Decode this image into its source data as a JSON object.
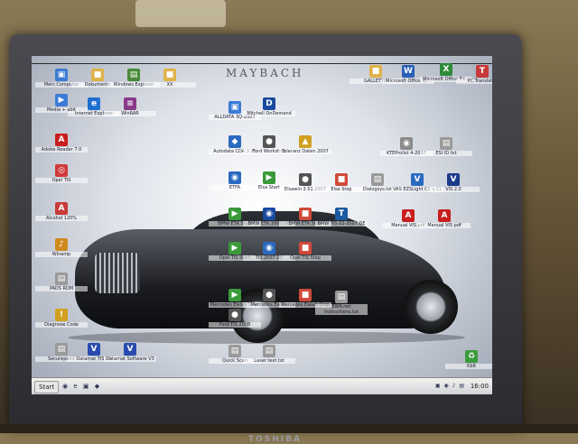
{
  "wallpaper": {
    "title": "MAYBACH"
  },
  "monitor": {
    "brand": "TOSHIBA"
  },
  "icons": [
    {
      "label": "Mein Computer",
      "name": "my-computer-icon",
      "color": "#3a7bd5",
      "glyph": "▣"
    },
    {
      "label": "Dokumente",
      "name": "documents-folder-icon",
      "color": "#e0b24a",
      "glyph": "■"
    },
    {
      "label": "Windows Explorer",
      "name": "windows-explorer-icon",
      "color": "#4a8a3a",
      "glyph": "▤"
    },
    {
      "label": "XX",
      "name": "folder-icon",
      "color": "#e0b24a",
      "glyph": "■"
    },
    {
      "label": "GALLETTO",
      "name": "galletto-folder-icon",
      "color": "#e0b24a",
      "glyph": "■"
    },
    {
      "label": "Microsoft Office W...",
      "name": "ms-word-icon",
      "color": "#2a5fb8",
      "glyph": "W"
    },
    {
      "label": "Microsoft Office Ex...",
      "name": "ms-excel-icon",
      "color": "#2e8b3a",
      "glyph": "X"
    },
    {
      "label": "PC Translator",
      "name": "pc-translator-icon",
      "color": "#c83a3a",
      "glyph": "T"
    },
    {
      "label": "Media + ablt",
      "name": "media-player-icon",
      "color": "#3a7bd5",
      "glyph": "▶"
    },
    {
      "label": "Internet Explorer",
      "name": "internet-explorer-icon",
      "color": "#1f6fcf",
      "glyph": "e"
    },
    {
      "label": "WinRAR",
      "name": "winrar-icon",
      "color": "#8a3a8a",
      "glyph": "≡"
    },
    {
      "label": "ALLDATA 3Q-2007",
      "name": "alldata-icon",
      "color": "#3a7bd5",
      "glyph": "▣"
    },
    {
      "label": "Mitchell OnDemand",
      "name": "mitchell-ondemand-icon",
      "color": "#1a4aa0",
      "glyph": "D"
    },
    {
      "label": "Adobe Reader 7.0",
      "name": "adobe-reader-icon",
      "color": "#c81e1e",
      "glyph": "A"
    },
    {
      "label": "Autodata CDA 3.15",
      "name": "autodata-icon",
      "color": "#2a6ac0",
      "glyph": "◆"
    },
    {
      "label": "Ford Workshop",
      "name": "ford-workshop-icon",
      "color": "#555",
      "glyph": "●"
    },
    {
      "label": "Toleranz Daten 2007",
      "name": "toleranz-daten-icon",
      "color": "#d0a020",
      "glyph": "▲"
    },
    {
      "label": "KTEProlist 4-2007",
      "name": "kte-prolist-icon",
      "color": "#8a8a8a",
      "glyph": "◉"
    },
    {
      "label": "ESI ID txt",
      "name": "esi-txt-icon",
      "color": "#9a9a9a",
      "glyph": "▤"
    },
    {
      "label": "Opel TIS",
      "name": "opel-tis-icon",
      "color": "#d03a3a",
      "glyph": "◎"
    },
    {
      "label": "ETFA",
      "name": "etfa-icon",
      "color": "#2a6ac0",
      "glyph": "◉"
    },
    {
      "label": "Elsa Start",
      "name": "elsa-start-icon",
      "color": "#3a9a3a",
      "glyph": "▶"
    },
    {
      "label": "Elsawin 3.51 2007",
      "name": "elsawin-icon",
      "color": "#555",
      "glyph": "●"
    },
    {
      "label": "Elsa Stop",
      "name": "elsa-stop-icon",
      "color": "#d04a3a",
      "glyph": "■"
    },
    {
      "label": "Dialogsys.txt",
      "name": "dialogsys-txt-icon",
      "color": "#9a9a9a",
      "glyph": "▤"
    },
    {
      "label": "VAS EZSLight CE v.11",
      "name": "vas-icon",
      "color": "#2a6ac0",
      "glyph": "V"
    },
    {
      "label": "VIS 2.0",
      "name": "vis-icon",
      "color": "#1a3a8a",
      "glyph": "V"
    },
    {
      "label": "Alcohol 120%",
      "name": "alcohol-icon",
      "color": "#c83a3a",
      "glyph": "A"
    },
    {
      "label": "BMW ETK Start",
      "name": "bmw-etk-start-icon",
      "color": "#3a9a3a",
      "glyph": "▶"
    },
    {
      "label": "BMW ETK 2007 DE",
      "name": "bmw-etk-icon",
      "color": "#1a4aa0",
      "glyph": "◉"
    },
    {
      "label": "BMW ETK Stop",
      "name": "bmw-etk-stop-icon",
      "color": "#d04a3a",
      "glyph": "■"
    },
    {
      "label": "BMW TIS 02-2007 DE",
      "name": "bmw-tis-icon",
      "color": "#1a5aa0",
      "glyph": "T"
    },
    {
      "label": "Manual VIS.pdf",
      "name": "manual-vis-pdf-icon",
      "color": "#c81e1e",
      "glyph": "A"
    },
    {
      "label": "Manual VIS pdf",
      "name": "manual-vis-pdf-2-icon",
      "color": "#c81e1e",
      "glyph": "A"
    },
    {
      "label": "Winamp",
      "name": "winamp-icon",
      "color": "#d08a20",
      "glyph": "♪"
    },
    {
      "label": "Opel TIS Start",
      "name": "opel-tis-start-icon",
      "color": "#3a9a3a",
      "glyph": "▶"
    },
    {
      "label": "TIS 2007 DE",
      "name": "tis-2007-icon",
      "color": "#2a6ac0",
      "glyph": "◉"
    },
    {
      "label": "Opel TIS Stop",
      "name": "opel-tis-stop-icon",
      "color": "#d04a3a",
      "glyph": "■"
    },
    {
      "label": "Mercedes Ewlab Start",
      "name": "mercedes-start-icon",
      "color": "#3a9a3a",
      "glyph": "▶"
    },
    {
      "label": "Mercedes Ewlab",
      "name": "mercedes-ewlab-icon",
      "color": "#555",
      "glyph": "●"
    },
    {
      "label": "Mercedes Ewlab Stop",
      "name": "mercedes-stop-icon",
      "color": "#d04a3a",
      "glyph": "■"
    },
    {
      "label": "EWA.net Instructions.txt",
      "name": "ewa-txt-icon",
      "color": "#9a9a9a",
      "glyph": "▤"
    },
    {
      "label": "PADS RDM",
      "name": "pads-icon",
      "color": "#9a9a9a",
      "glyph": "▤"
    },
    {
      "label": "Ford TIS 2008",
      "name": "ford-tis-icon",
      "color": "#555",
      "glyph": "●"
    },
    {
      "label": "Diagnose Code",
      "name": "diagnose-code-icon",
      "color": "#d0a020",
      "glyph": "!"
    },
    {
      "label": "Securepoint",
      "name": "securepoint-icon",
      "color": "#9a9a9a",
      "glyph": "▤"
    },
    {
      "label": "Datamat TIS V3",
      "name": "datamat-tis-icon",
      "color": "#2a4ab0",
      "glyph": "V"
    },
    {
      "label": "Datamat Software V3",
      "name": "datamat-software-icon",
      "color": "#2a4ab0",
      "glyph": "V"
    },
    {
      "label": "Quick Scan",
      "name": "quick-scan-icon",
      "color": "#9a9a9a",
      "glyph": "▤"
    },
    {
      "label": "Laser text.txt",
      "name": "laser-txt-icon",
      "color": "#9a9a9a",
      "glyph": "▤"
    },
    {
      "label": "Kb8",
      "name": "recycle-bin-icon",
      "color": "#3a9a3a",
      "glyph": "♻"
    }
  ],
  "taskbar": {
    "start_label": "Start",
    "quick_launch": "◉ e ▣ ◆",
    "tray_icons": "▣ ◉ ♪ ▤",
    "clock": "16:00"
  }
}
